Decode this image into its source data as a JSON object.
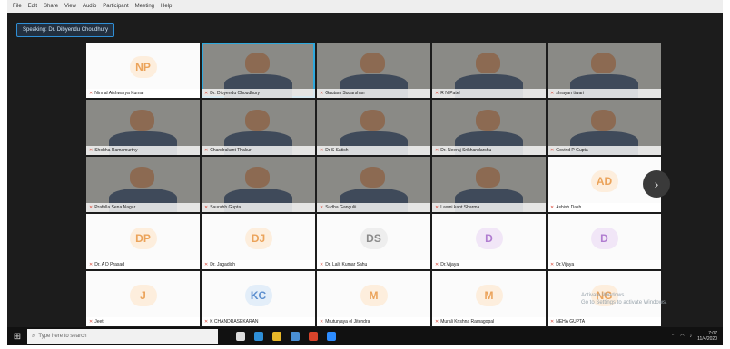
{
  "menubar": [
    "File",
    "Edit",
    "Share",
    "View",
    "Audio",
    "Participant",
    "Meeting",
    "Help"
  ],
  "speaking_label": "Speaking: Dr. Dibyendu Choudhury",
  "tiles": [
    {
      "type": "avatar",
      "initials": "NP",
      "color": "orange",
      "name": "Nirmal Aishwarya Kumar"
    },
    {
      "type": "video",
      "name": "Dr. Dibyendu Choudhury",
      "active": true,
      "palette": "v1"
    },
    {
      "type": "video",
      "name": "Gautam Sudarshan",
      "palette": "v2"
    },
    {
      "type": "video",
      "name": "R N Patel",
      "palette": "v3"
    },
    {
      "type": "video",
      "name": "shrayan tiwari",
      "palette": "v6"
    },
    {
      "type": "video",
      "name": "Shobha Ramamurthy",
      "palette": "v5"
    },
    {
      "type": "video",
      "name": "Chandrakant Thakur",
      "palette": "v8"
    },
    {
      "type": "video",
      "name": "Dr S Satish",
      "palette": "v7"
    },
    {
      "type": "video",
      "name": "Dr. Neeraj Srikhandarshu",
      "palette": "v9"
    },
    {
      "type": "video",
      "name": "Govind P Gupta",
      "palette": "v4"
    },
    {
      "type": "video",
      "name": "Prafulla Sena Nagar",
      "palette": "v3"
    },
    {
      "type": "video",
      "name": "Saurabh Gupta",
      "palette": "v6"
    },
    {
      "type": "video",
      "name": "Sudha Gangulii",
      "palette": "v5"
    },
    {
      "type": "video",
      "name": "Laxmi kant Sharma",
      "palette": "v10"
    },
    {
      "type": "avatar",
      "initials": "AD",
      "color": "orange",
      "name": "Ashish Dash"
    },
    {
      "type": "avatar",
      "initials": "DP",
      "color": "orange",
      "name": "Dr. A D Prasad"
    },
    {
      "type": "avatar",
      "initials": "DJ",
      "color": "orange",
      "name": "Dr. Jagadish"
    },
    {
      "type": "avatar",
      "initials": "DS",
      "color": "gray",
      "name": "Dr. Lalit Kumar Sahu"
    },
    {
      "type": "avatar",
      "initials": "D",
      "color": "purple",
      "name": "Dr.Vijaya"
    },
    {
      "type": "avatar",
      "initials": "D",
      "color": "purple",
      "name": "Dr.Vijaya"
    },
    {
      "type": "avatar",
      "initials": "J",
      "color": "orange",
      "name": "Jeet"
    },
    {
      "type": "avatar",
      "initials": "KC",
      "color": "blue",
      "name": "K CHANDRASEKARAN"
    },
    {
      "type": "avatar",
      "initials": "M",
      "color": "orange",
      "name": "Mrutunjaya el Jitendra"
    },
    {
      "type": "avatar",
      "initials": "M",
      "color": "orange",
      "name": "Murali Krishna Ramagopal"
    },
    {
      "type": "avatar",
      "initials": "NG",
      "color": "orange",
      "name": "NEHA GUPTA"
    }
  ],
  "next_page": "›",
  "watermark": {
    "line1": "Activate Windows",
    "line2": "Go to Settings to activate Windows."
  },
  "taskbar": {
    "search_placeholder": "Type here to search",
    "time": "7:07",
    "date": "11/4/2020"
  },
  "colors": {
    "accent": "#2fa9dd",
    "background": "#1c1c1c",
    "muted_red": "#d94a3a"
  }
}
